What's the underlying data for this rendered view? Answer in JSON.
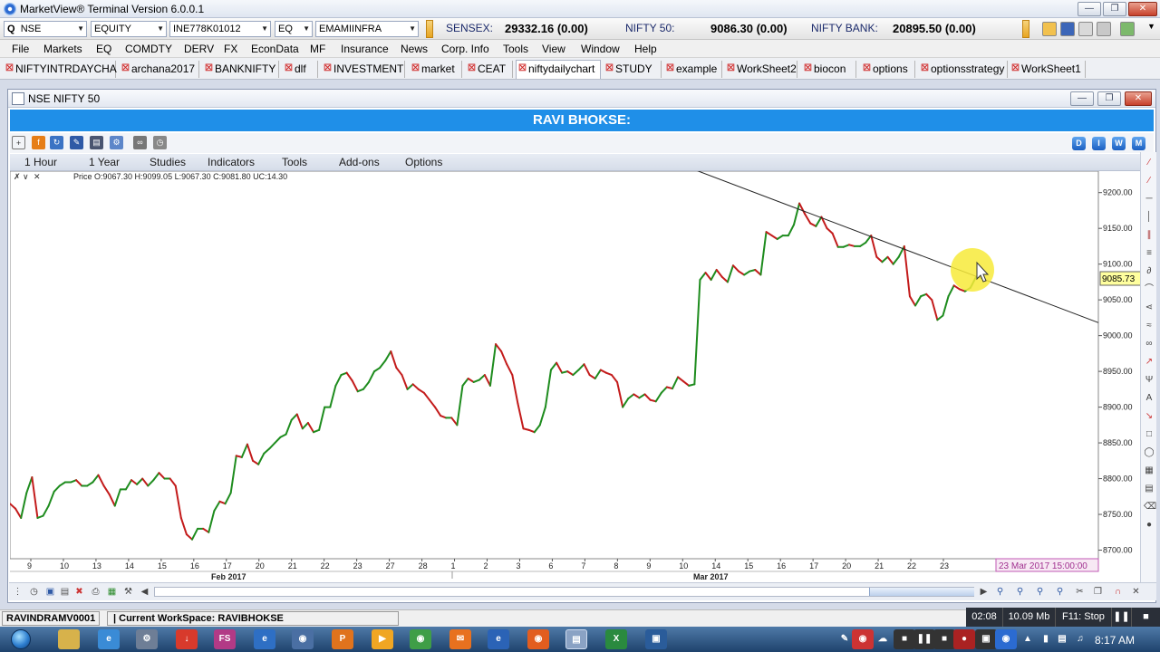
{
  "app": {
    "title": "MarketView®  Terminal Version  6.0.0.1"
  },
  "toolbar": {
    "exchange": "NSE",
    "segment": "EQUITY",
    "isin": "INE778K01012",
    "series": "EQ",
    "symbol": "EMAMIINFRA",
    "q_label": "Q",
    "indices": [
      {
        "label": "SENSEX:",
        "value": "29332.16 (0.00)"
      },
      {
        "label": "NIFTY 50:",
        "value": "9086.30 (0.00)"
      },
      {
        "label": "NIFTY BANK:",
        "value": "20895.50 (0.00)"
      }
    ]
  },
  "menu": [
    "File",
    "Markets",
    "EQ",
    "COMDTY",
    "DERV",
    "FX",
    "EconData",
    "MF",
    "Insurance",
    "News",
    "Corp. Info",
    "Tools",
    "View",
    "Window",
    "Help"
  ],
  "tabs": [
    {
      "label": "NIFTYINTRDAYCHA",
      "active": false
    },
    {
      "label": "archana2017",
      "active": false
    },
    {
      "label": "BANKNIFTY",
      "active": false
    },
    {
      "label": "dlf",
      "active": false
    },
    {
      "label": "INVESTMENT",
      "active": false
    },
    {
      "label": "market",
      "active": false
    },
    {
      "label": "CEAT",
      "active": false
    },
    {
      "label": "niftydailychart",
      "active": true
    },
    {
      "label": "STUDY",
      "active": false
    },
    {
      "label": "example",
      "active": false
    },
    {
      "label": "WorkSheet2",
      "active": false
    },
    {
      "label": "biocon",
      "active": false
    },
    {
      "label": "options",
      "active": false
    },
    {
      "label": "optionsstrategy",
      "active": false
    },
    {
      "label": "WorkSheet1",
      "active": false
    }
  ],
  "chart_window": {
    "title": "NSE NIFTY 50",
    "banner": "RAVI BHOKSE:",
    "menu": [
      "1 Hour",
      "1 Year",
      "Studies",
      "Indicators",
      "Tools",
      "Add-ons",
      "Options"
    ],
    "right_buttons": [
      "D",
      "I",
      "W",
      "M"
    ],
    "price_readout": "Price O:9067.30  H:9099.05  L:9067.30  C:9081.80  UC:14.30",
    "current_price": "9085.73",
    "crosshair_date": "23 Mar 2017 15:00:00"
  },
  "chart_data": {
    "type": "line",
    "title": "",
    "xlabel": "",
    "ylabel": "",
    "y_ticks": [
      "9200.00",
      "9150.00",
      "9100.00",
      "9050.00",
      "9000.00",
      "8950.00",
      "8900.00",
      "8850.00",
      "8800.00",
      "8750.00",
      "8700.00"
    ],
    "ylim": [
      8688,
      9230
    ],
    "x_ticks": [
      "9",
      "10",
      "13",
      "14",
      "15",
      "16",
      "17",
      "20",
      "21",
      "22",
      "23",
      "27",
      "28",
      "1",
      "2",
      "3",
      "6",
      "7",
      "8",
      "9",
      "10",
      "14",
      "15",
      "16",
      "17",
      "20",
      "21",
      "22",
      "23"
    ],
    "month_labels": [
      "Feb 2017",
      "Mar 2017"
    ],
    "series": [
      {
        "values": [
          8765,
          8758,
          8745,
          8780,
          8802,
          8745,
          8748,
          8762,
          8782,
          8790,
          8795,
          8795,
          8798,
          8790,
          8790,
          8795,
          8805,
          8790,
          8778,
          8762,
          8785,
          8785,
          8798,
          8792,
          8800,
          8790,
          8798,
          8808,
          8800,
          8800,
          8790,
          8745,
          8722,
          8715,
          8730,
          8730,
          8725,
          8755,
          8768,
          8765,
          8780,
          8832,
          8830,
          8848,
          8825,
          8820,
          8835,
          8842,
          8850,
          8858,
          8862,
          8882,
          8890,
          8870,
          8878,
          8865,
          8868,
          8900,
          8900,
          8930,
          8945,
          8948,
          8937,
          8922,
          8925,
          8935,
          8950,
          8955,
          8965,
          8978,
          8955,
          8945,
          8925,
          8932,
          8925,
          8920,
          8910,
          8900,
          8888,
          8885,
          8885,
          8875,
          8930,
          8940,
          8935,
          8938,
          8945,
          8930,
          8988,
          8978,
          8960,
          8945,
          8905,
          8870,
          8868,
          8865,
          8875,
          8900,
          8952,
          8962,
          8948,
          8950,
          8945,
          8952,
          8960,
          8945,
          8940,
          8952,
          8948,
          8945,
          8935,
          8900,
          8912,
          8918,
          8913,
          8918,
          8910,
          8908,
          8920,
          8928,
          8926,
          8942,
          8936,
          8930,
          8932,
          9078,
          9088,
          9078,
          9092,
          9082,
          9075,
          9098,
          9090,
          9085,
          9090,
          9092,
          9085,
          9145,
          9140,
          9135,
          9140,
          9140,
          9155,
          9185,
          9170,
          9157,
          9153,
          9166,
          9150,
          9143,
          9124,
          9124,
          9127,
          9125,
          9125,
          9130,
          9140,
          9110,
          9103,
          9110,
          9100,
          9110,
          9125,
          9055,
          9042,
          9055,
          9058,
          9050,
          9022,
          9028,
          9055,
          9070,
          9065,
          9062,
          9067,
          9082
        ]
      }
    ],
    "trendline": {
      "from_index": 124,
      "from_value": 9232,
      "to_index": 176,
      "to_value": 9080
    }
  },
  "status": {
    "user": "RAVINDRAMV0001",
    "workspace": "| Current WorkSpace: RAVIBHOKSE",
    "time": "02:08",
    "memory": "10.09 Mb",
    "f11": "F11: Stop"
  },
  "taskbar": {
    "clock": "8:17 AM",
    "apps": [
      "explorer",
      "ie-old",
      "tool",
      "download",
      "FS",
      "ie",
      "p",
      "media",
      "chrome",
      "mail",
      "edge",
      "firefox",
      "terminal",
      "excel",
      "screen"
    ]
  },
  "colors": {
    "up": "#1e8c1e",
    "down": "#c31b1b",
    "banner": "#1f8fe8"
  }
}
